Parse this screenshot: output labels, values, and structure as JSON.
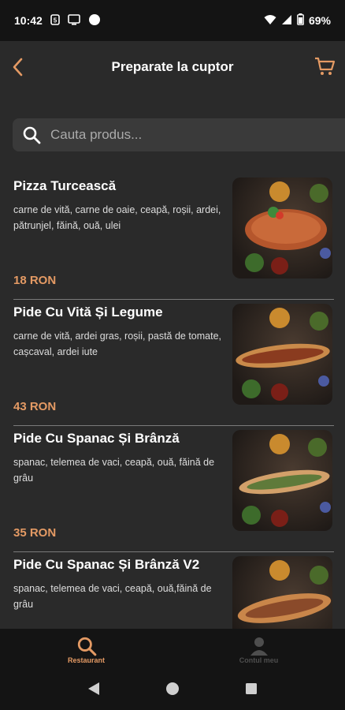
{
  "status_bar": {
    "time": "10:42",
    "battery": "69%"
  },
  "header": {
    "title": "Preparate la cuptor"
  },
  "search": {
    "placeholder": "Cauta produs..."
  },
  "products": [
    {
      "name": "Pizza Turcească",
      "description": "carne de vită, carne de oaie, ceapă, roșii, ardei, pătrunjel, făină, ouă, ulei",
      "price": "18 RON"
    },
    {
      "name": "Pide Cu Vită Și Legume",
      "description": "carne de vită, ardei gras, roșii, pastă de tomate, cașcaval, ardei iute",
      "price": "43 RON"
    },
    {
      "name": "Pide Cu Spanac Și Brânză",
      "description": "spanac, telemea de vaci, ceapă, ouă, făină de grâu",
      "price": "35 RON"
    },
    {
      "name": "Pide Cu Spanac Și Brânză V2",
      "description": "spanac, telemea de vaci, ceapă, ouă,făină de grâu",
      "price": ""
    }
  ],
  "bottom_nav": {
    "items": [
      {
        "label": "Restaurant",
        "icon": "search-icon",
        "active": true
      },
      {
        "label": "Contul meu",
        "icon": "person-icon",
        "active": false
      }
    ]
  },
  "colors": {
    "accent": "#e49a64",
    "background": "#2a2a2a",
    "bar": "#141414"
  }
}
